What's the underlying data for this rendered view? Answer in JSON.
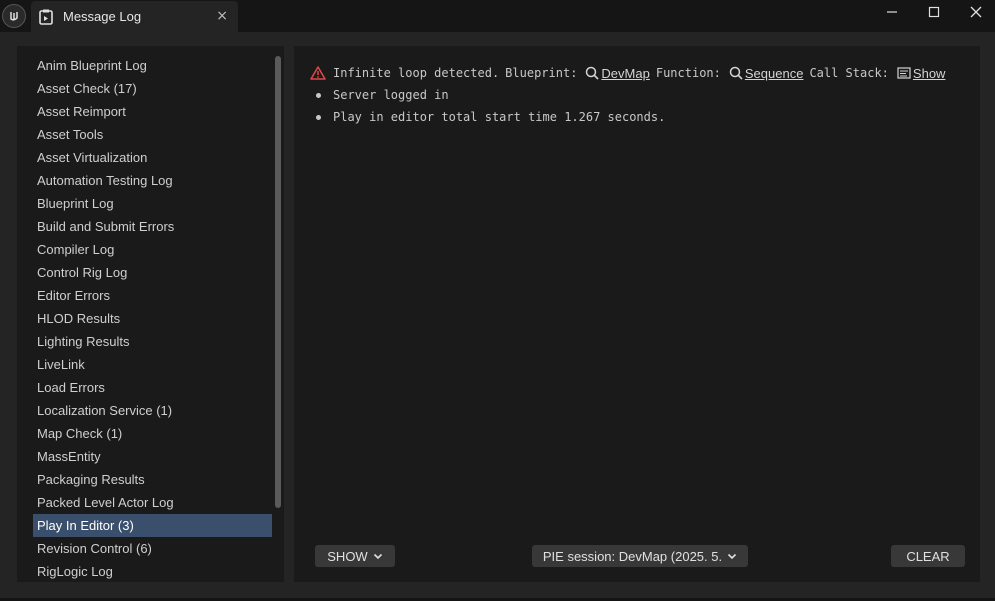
{
  "window": {
    "tab_title": "Message Log",
    "tab_close": "×"
  },
  "categories": [
    "Anim Blueprint Log",
    "Asset Check (17)",
    "Asset Reimport",
    "Asset Tools",
    "Asset Virtualization",
    "Automation Testing Log",
    "Blueprint Log",
    "Build and Submit Errors",
    "Compiler Log",
    "Control Rig Log",
    "Editor Errors",
    "HLOD Results",
    "Lighting Results",
    "LiveLink",
    "Load Errors",
    "Localization Service (1)",
    "Map Check (1)",
    "MassEntity",
    "Packaging Results",
    "Packed Level Actor Log",
    "Play In Editor (3)",
    "Revision Control (6)",
    "RigLogic Log"
  ],
  "selected_category": "Play In Editor (3)",
  "log": {
    "error": {
      "text": "Infinite loop detected.",
      "blueprint_label": "Blueprint:",
      "blueprint_link": "DevMap",
      "function_label": "Function:",
      "function_link": "Sequence",
      "callstack_label": "Call Stack:",
      "callstack_link": "Show"
    },
    "info": [
      "Server logged in",
      "Play in editor total start time 1.267 seconds."
    ]
  },
  "footer": {
    "show_label": "SHOW",
    "session_label": "PIE session: DevMap (2025. 5.",
    "clear_label": "CLEAR"
  },
  "colors": {
    "selection": "#3a4f6b",
    "error_icon": "#e04848"
  }
}
